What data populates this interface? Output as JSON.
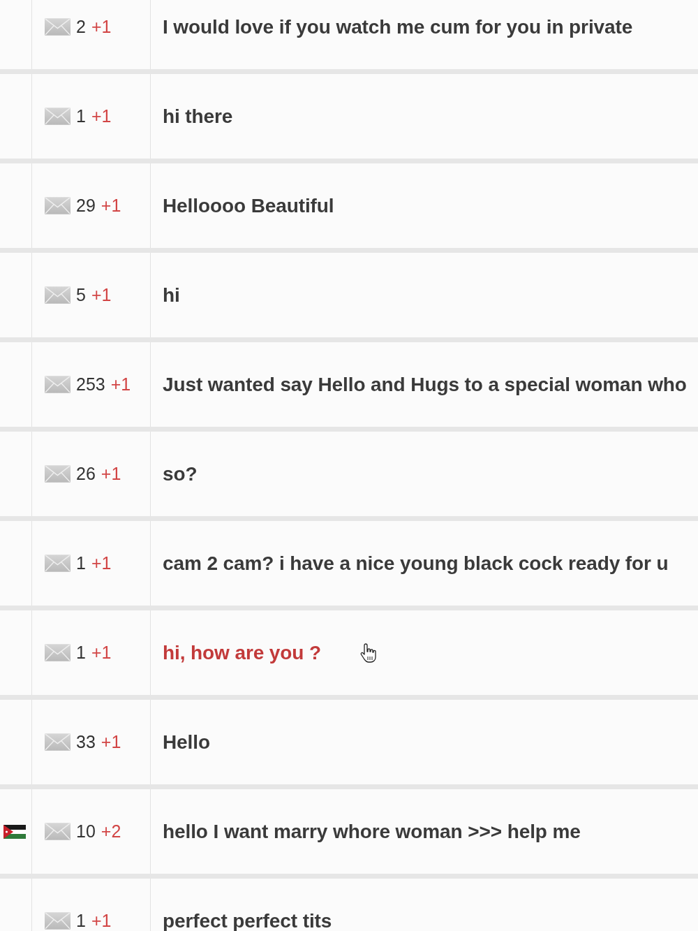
{
  "messages": [
    {
      "flag": false,
      "count": "2",
      "new_count": "+1",
      "text": "I would love if you watch me cum for you in private",
      "hovered": false
    },
    {
      "flag": false,
      "count": "1",
      "new_count": "+1",
      "text": "hi there",
      "hovered": false
    },
    {
      "flag": false,
      "count": "29",
      "new_count": "+1",
      "text": "Helloooo Beautiful",
      "hovered": false
    },
    {
      "flag": false,
      "count": "5",
      "new_count": "+1",
      "text": "hi",
      "hovered": false
    },
    {
      "flag": false,
      "count": "253",
      "new_count": "+1",
      "text": "Just wanted say Hello and Hugs to a special woman who",
      "hovered": false
    },
    {
      "flag": false,
      "count": "26",
      "new_count": "+1",
      "text": "so?",
      "hovered": false
    },
    {
      "flag": false,
      "count": "1",
      "new_count": "+1",
      "text": "cam 2 cam? i have a nice young black cock ready for u",
      "hovered": false
    },
    {
      "flag": false,
      "count": "1",
      "new_count": "+1",
      "text": "hi, how are you ?",
      "hovered": true
    },
    {
      "flag": false,
      "count": "33",
      "new_count": "+1",
      "text": "Hello",
      "hovered": false
    },
    {
      "flag": true,
      "count": "10",
      "new_count": "+2",
      "text": "hello I want marry whore woman >>> help me",
      "hovered": false
    },
    {
      "flag": false,
      "count": "1",
      "new_count": "+1",
      "text": "perfect perfect tits",
      "hovered": false
    }
  ]
}
